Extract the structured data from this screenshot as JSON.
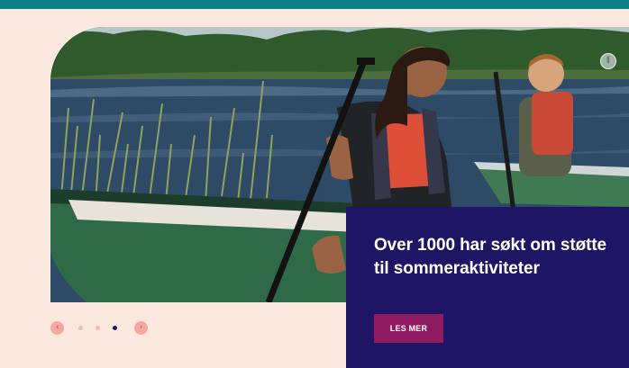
{
  "promo": {
    "title": "Over 1000 har søkt om støtte til sommeraktiviteter",
    "button_label": "LES MER"
  },
  "carousel": {
    "prev_symbol": "‹",
    "next_symbol": "›",
    "slide_count": 4,
    "active_index": 3
  },
  "colors": {
    "top_bar": "#0e7f84",
    "panel_bg": "#fbe9df",
    "promo_bg": "#1e1565",
    "button_bg": "#8f1a62",
    "arrow_bg": "#f4a8a1",
    "dot_inactive": "#f2b9b2",
    "dot_active": "#1e1565"
  }
}
